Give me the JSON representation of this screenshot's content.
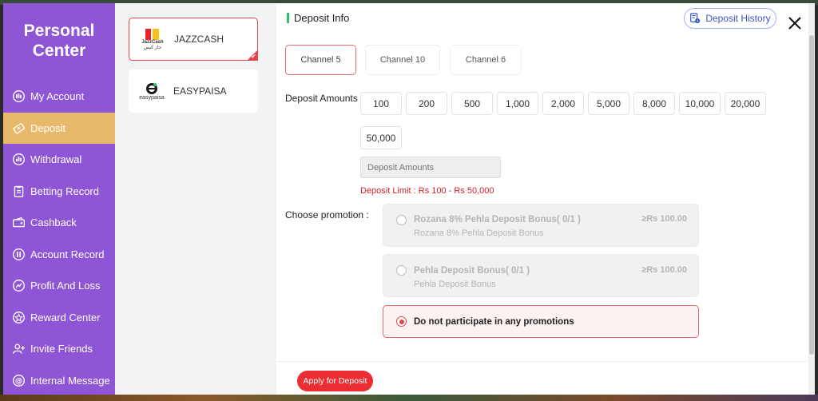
{
  "sidebar": {
    "title_line1": "Personal",
    "title_line2": "Center",
    "items": [
      {
        "label": "My Account",
        "icon": "account-icon"
      },
      {
        "label": "Deposit",
        "icon": "deposit-icon"
      },
      {
        "label": "Withdrawal",
        "icon": "withdrawal-icon"
      },
      {
        "label": "Betting Record",
        "icon": "clipboard-icon"
      },
      {
        "label": "Cashback",
        "icon": "cashback-icon"
      },
      {
        "label": "Account Record",
        "icon": "record-icon"
      },
      {
        "label": "Profit And Loss",
        "icon": "profit-icon"
      },
      {
        "label": "Reward Center",
        "icon": "reward-icon"
      },
      {
        "label": "Invite Friends",
        "icon": "invite-icon"
      },
      {
        "label": "Internal Message",
        "icon": "message-icon"
      }
    ],
    "active_index": 1
  },
  "methods": [
    {
      "name": "JAZZCASH",
      "logo_text": "JazzCash",
      "logo_sub": "جاز کیش",
      "selected": true
    },
    {
      "name": "EASYPAISA",
      "logo_text": "easypaisa",
      "selected": false
    }
  ],
  "main": {
    "section_title": "Deposit Info",
    "history_label": "Deposit History",
    "channels": [
      "Channel 5",
      "Channel 10",
      "Channel 6"
    ],
    "active_channel": 0,
    "amounts_label": "Deposit Amounts :",
    "amounts": [
      "100",
      "200",
      "500",
      "1,000",
      "2,000",
      "5,000",
      "8,000",
      "10,000",
      "20,000",
      "50,000"
    ],
    "amount_placeholder": "Deposit Amounts",
    "limit_text": "Deposit Limit : Rs  100  - Rs  50,000",
    "promotion_label": "Choose promotion :",
    "promotions": [
      {
        "title": "Rozana 8% Pehla Deposit Bonus( 0/1 )",
        "subtitle": "Rozana 8% Pehla Deposit Bonus",
        "amount": "≥Rs  100.00",
        "selected": false
      },
      {
        "title": "Pehla Deposit Bonus( 0/1 )",
        "subtitle": "Pehla Deposit Bonus",
        "amount": "≥Rs  100.00",
        "selected": false
      },
      {
        "title": "Do not participate in any promotions",
        "selected": true
      }
    ],
    "apply_label": "Apply for Deposit"
  },
  "colors": {
    "sidebar": "#8e56d6",
    "active_nav": "#e8b96a",
    "accent_red": "#ec2d33",
    "green_bar": "#2ec26a",
    "link_blue": "#3d56c4"
  }
}
